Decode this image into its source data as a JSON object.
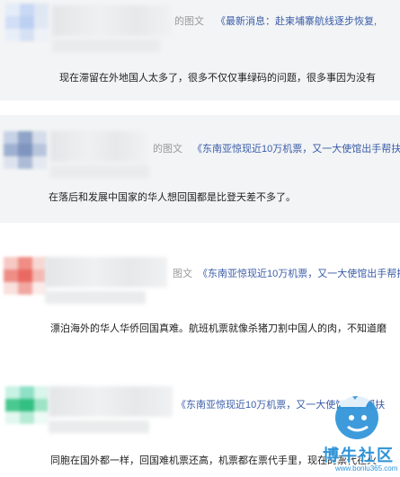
{
  "comments": [
    {
      "meta": "的图文",
      "link": "《最新消息：赴柬埔寨航线逐步恢复,",
      "body": "现在滞留在外地国人太多了，很多不仅仅事绿码的问题，很多事因为没有"
    },
    {
      "meta": "的图文",
      "link": "《东南亚惊现近10万机票，又一大使馆出手帮扶",
      "body": "在落后和发展中国家的华人想回国都是比登天差不多了。"
    },
    {
      "meta": "图文",
      "link": "《东南亚惊现近10万机票，又一大使馆出手帮扶",
      "body": "漂泊海外的华人华侨回国真难。航班机票就像杀猪刀割中国人的肉，不知道磨"
    },
    {
      "meta": "",
      "link": "《东南亚惊现近10万机票，又一大使馆出手帮扶",
      "body": "同胞在国外都一样，回国难机票还高，机票都在票代手里，现在的票代在火"
    }
  ],
  "watermark": {
    "text": "博牛社区",
    "url": "www.bonlu365.com",
    "color": "#2d93d8"
  }
}
